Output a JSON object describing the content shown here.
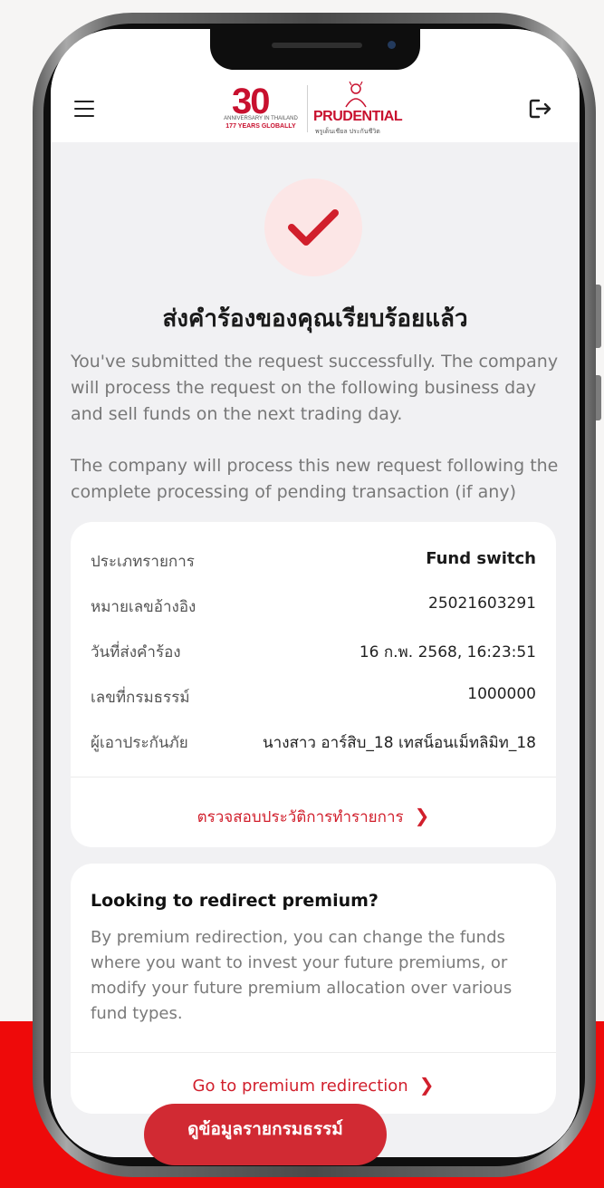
{
  "header": {
    "logo_30": {
      "digits": "30",
      "caption_line1": "ANNIVERSARY IN THAILAND",
      "caption_line2": "177 YEARS GLOBALLY"
    },
    "logo_prudential": {
      "brand": "PRUDENTIAL",
      "thai": "พรูเด็นเชียล ประกันชีวิต"
    }
  },
  "success": {
    "title": "ส่งคำร้องของคุณเรียบร้อยแล้ว",
    "message1": "You've submitted the request successfully. The company will process the request on the following business day and sell funds on the next trading day.",
    "message2": "The company will process this new request following the complete processing of pending transaction (if any)"
  },
  "details": {
    "rows": [
      {
        "label": "ประเภทรายการ",
        "value": "Fund switch"
      },
      {
        "label": "หมายเลขอ้างอิง",
        "value": "25021603291"
      },
      {
        "label": "วันที่ส่งคำร้อง",
        "value": "16 ก.พ. 2568, 16:23:51"
      },
      {
        "label": "เลขที่กรมธรรม์",
        "value": "1000000"
      },
      {
        "label": "ผู้เอาประกันภัย",
        "value": "นางสาว อาร์สิบ_18 เทสน็อนเม็ทลิมิท_18"
      }
    ],
    "history_link": "ตรวจสอบประวัติการทำรายการ"
  },
  "promo": {
    "title": "Looking to redirect premium?",
    "text": "By premium redirection, you can change the funds where you want to invest your future premiums, or modify your future premium allocation over various fund types.",
    "link": "Go to premium redirection"
  },
  "bottom_button": "ดูข้อมูลรายกรมธรรม์",
  "colors": {
    "brand_red": "#d11f2c",
    "background_red": "#ee0a0a",
    "check_bg": "#fce6e6"
  },
  "icons": [
    "menu-icon",
    "logout-icon",
    "check-icon",
    "chevron-right-icon"
  ]
}
